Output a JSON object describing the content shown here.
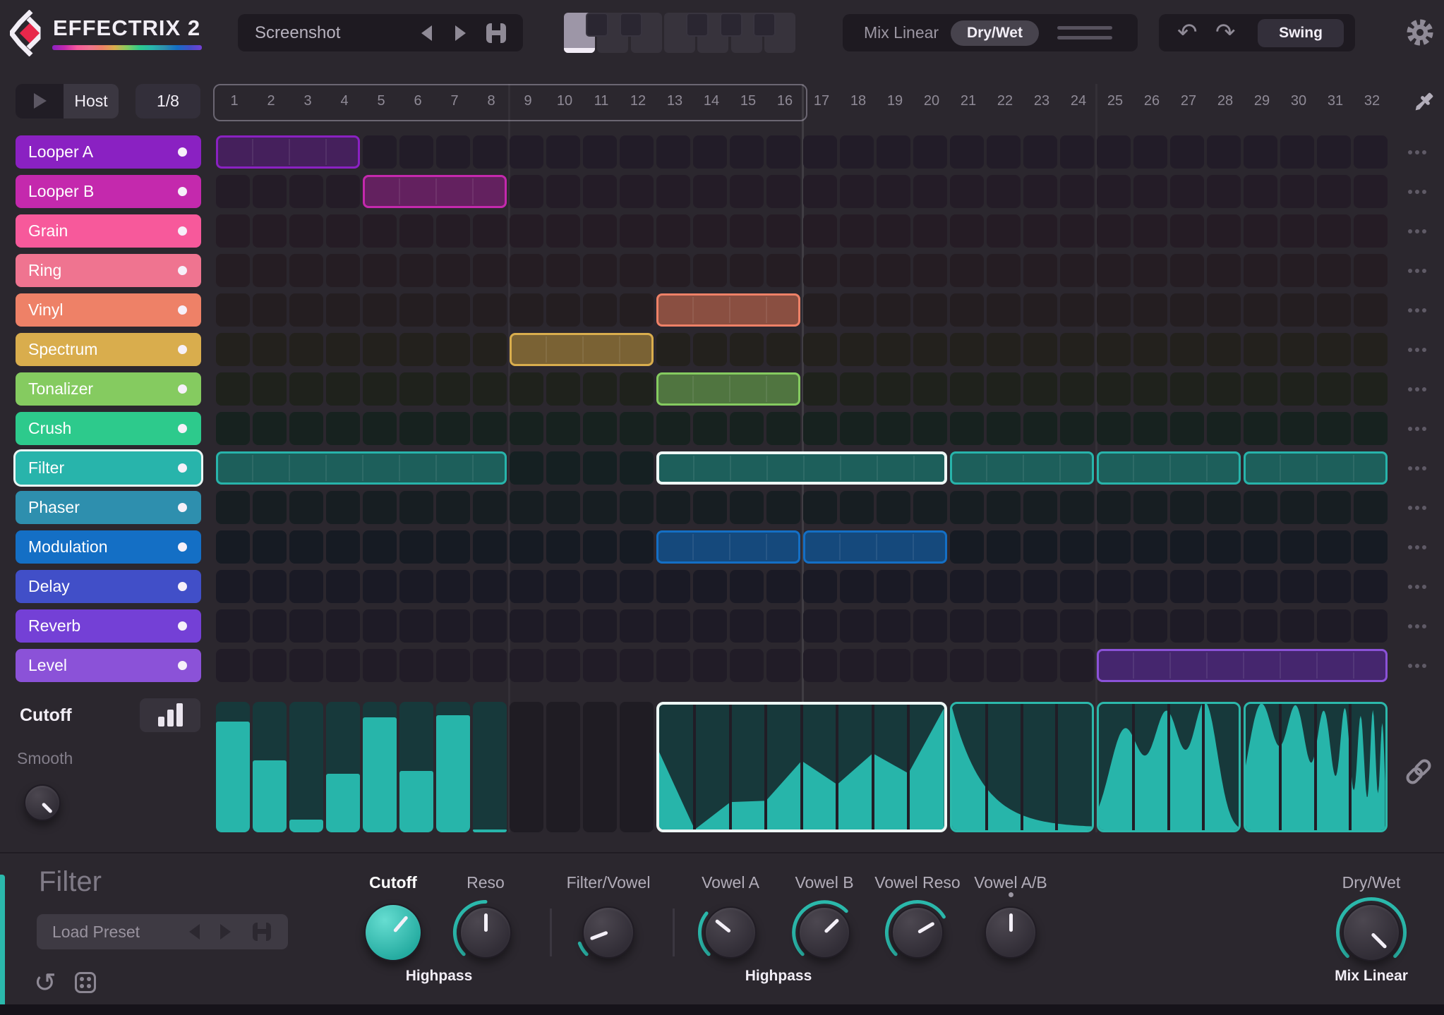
{
  "app": {
    "title": "EFFECTRIX 2",
    "accent": "#2bb9ac",
    "background": "#2b272e"
  },
  "header": {
    "preset": {
      "name": "Screenshot"
    },
    "pattern_selector": {
      "white_keys": 7,
      "black_key_positions": [
        1,
        2,
        4,
        5,
        6
      ],
      "selected_key": 0
    },
    "mix_linear_label": "Mix Linear",
    "dry_wet_label": "Dry/Wet",
    "swing_label": "Swing"
  },
  "transport": {
    "host_label": "Host",
    "rate_label": "1/8"
  },
  "timeline": {
    "steps": [
      1,
      2,
      3,
      4,
      5,
      6,
      7,
      8,
      9,
      10,
      11,
      12,
      13,
      14,
      15,
      16,
      17,
      18,
      19,
      20,
      21,
      22,
      23,
      24,
      25,
      26,
      27,
      28,
      29,
      30,
      31,
      32
    ],
    "loop_start": 1,
    "loop_end": 16
  },
  "tracks": [
    {
      "name": "Looper A",
      "color": "#8a21c2",
      "block_fill": "#45205c",
      "cell_tint": "#221c28",
      "enabled": true,
      "blocks": [
        {
          "start": 1,
          "length": 4
        }
      ]
    },
    {
      "name": "Looper B",
      "color": "#c429ad",
      "block_fill": "#63215f",
      "cell_tint": "#241c27",
      "enabled": true,
      "blocks": [
        {
          "start": 5,
          "length": 4
        }
      ]
    },
    {
      "name": "Grain",
      "color": "#f7599b",
      "block_fill": "#7a3054",
      "cell_tint": "#251c25",
      "enabled": true,
      "blocks": []
    },
    {
      "name": "Ring",
      "color": "#ef7490",
      "block_fill": "#7c3f50",
      "cell_tint": "#251d23",
      "enabled": true,
      "blocks": []
    },
    {
      "name": "Vinyl",
      "color": "#ee8167",
      "block_fill": "#8a4f41",
      "cell_tint": "#241e21",
      "enabled": true,
      "blocks": [
        {
          "start": 13,
          "length": 4
        }
      ]
    },
    {
      "name": "Spectrum",
      "color": "#d9ad4d",
      "block_fill": "#7a6234",
      "cell_tint": "#23211d",
      "enabled": true,
      "blocks": [
        {
          "start": 9,
          "length": 4
        }
      ]
    },
    {
      "name": "Tonalizer",
      "color": "#85cb60",
      "block_fill": "#507540",
      "cell_tint": "#1f221c",
      "enabled": true,
      "blocks": [
        {
          "start": 13,
          "length": 4
        }
      ]
    },
    {
      "name": "Crush",
      "color": "#2dca8c",
      "block_fill": "#1e6e52",
      "cell_tint": "#17221f",
      "enabled": true,
      "blocks": []
    },
    {
      "name": "Filter",
      "color": "#28b4ab",
      "block_fill": "#1d5f5b",
      "cell_tint": "#152022",
      "enabled": true,
      "selected": true,
      "blocks": [
        {
          "start": 1,
          "length": 8
        },
        {
          "start": 13,
          "length": 8,
          "selected": true
        },
        {
          "start": 21,
          "length": 4
        },
        {
          "start": 25,
          "length": 4
        },
        {
          "start": 29,
          "length": 4
        }
      ]
    },
    {
      "name": "Phaser",
      "color": "#2e8fae",
      "block_fill": "#1d5468",
      "cell_tint": "#171e22",
      "enabled": true,
      "blocks": []
    },
    {
      "name": "Modulation",
      "color": "#146fc5",
      "block_fill": "#15497c",
      "cell_tint": "#161b23",
      "enabled": true,
      "blocks": [
        {
          "start": 13,
          "length": 4
        },
        {
          "start": 17,
          "length": 4
        }
      ]
    },
    {
      "name": "Delay",
      "color": "#414fc8",
      "block_fill": "#2c367e",
      "cell_tint": "#1a1a25",
      "enabled": true,
      "blocks": []
    },
    {
      "name": "Reverb",
      "color": "#7440d6",
      "block_fill": "#482a80",
      "cell_tint": "#1e1b26",
      "enabled": true,
      "blocks": []
    },
    {
      "name": "Level",
      "color": "#8b52d8",
      "block_fill": "#45266e",
      "cell_tint": "#211c27",
      "enabled": true,
      "blocks": [
        {
          "start": 25,
          "length": 8
        }
      ]
    }
  ],
  "automation": {
    "param_label": "Cutoff",
    "smooth_label": "Smooth",
    "smooth_value": 1.0,
    "lane_color": "#27b5aa",
    "lane_bg": "#17393b",
    "regions": [
      {
        "start": 1,
        "length": 8,
        "style": "bars",
        "selected": false,
        "values": [
          0.85,
          0.55,
          0.1,
          0.45,
          0.88,
          0.47,
          0.9,
          0.02
        ]
      },
      {
        "start": 13,
        "length": 8,
        "style": "polyline",
        "selected": true,
        "points": [
          [
            0,
            0.62
          ],
          [
            1,
            0.0
          ],
          [
            2,
            0.22
          ],
          [
            3,
            0.23
          ],
          [
            4,
            0.55
          ],
          [
            5,
            0.36
          ],
          [
            6,
            0.61
          ],
          [
            7,
            0.45
          ],
          [
            8,
            0.97
          ]
        ]
      },
      {
        "start": 21,
        "length": 4,
        "style": "decay",
        "selected": false,
        "from": 0.97,
        "to": 0.02
      },
      {
        "start": 25,
        "length": 4,
        "style": "bumps",
        "selected": false,
        "bumps": [
          {
            "c": 0.75,
            "w": 0.62,
            "h": 0.8
          },
          {
            "c": 1.95,
            "w": 0.55,
            "h": 0.92
          },
          {
            "c": 3.05,
            "w": 0.5,
            "h": 1.0
          }
        ]
      },
      {
        "start": 29,
        "length": 4,
        "style": "bumps",
        "selected": false,
        "bumps": [
          {
            "c": 0.45,
            "w": 0.55,
            "h": 1.0
          },
          {
            "c": 1.45,
            "w": 0.42,
            "h": 0.95
          },
          {
            "c": 2.25,
            "w": 0.3,
            "h": 0.92
          },
          {
            "c": 2.85,
            "w": 0.2,
            "h": 0.95
          },
          {
            "c": 3.3,
            "w": 0.14,
            "h": 0.9
          },
          {
            "c": 3.65,
            "w": 0.11,
            "h": 0.95
          },
          {
            "c": 3.92,
            "w": 0.09,
            "h": 0.85
          }
        ]
      }
    ]
  },
  "editor": {
    "title": "Filter",
    "preset_label": "Load Preset",
    "knobs": [
      {
        "label": "Cutoff",
        "value": 0.65,
        "filled": true,
        "arc": false,
        "active": true
      },
      {
        "label": "Reso",
        "value": 0.5,
        "filled": false,
        "arc": true,
        "active": false
      },
      {
        "label": "Filter/Vowel",
        "value": 0.09,
        "filled": false,
        "arc": true,
        "active": false
      },
      {
        "label": "Vowel A",
        "value": 0.31,
        "filled": false,
        "arc": true,
        "active": false
      },
      {
        "label": "Vowel B",
        "value": 0.67,
        "filled": false,
        "arc": true,
        "active": false
      },
      {
        "label": "Vowel Reso",
        "value": 0.72,
        "filled": false,
        "arc": true,
        "active": false
      },
      {
        "label": "Vowel A/B",
        "value": 0.5,
        "filled": false,
        "arc": false,
        "active": false,
        "center_mark": true
      },
      {
        "label": "Dry/Wet",
        "value": 1.0,
        "filled": false,
        "arc": true,
        "active": false
      }
    ],
    "group_labels": [
      "Highpass",
      "Highpass",
      "Mix Linear"
    ]
  }
}
